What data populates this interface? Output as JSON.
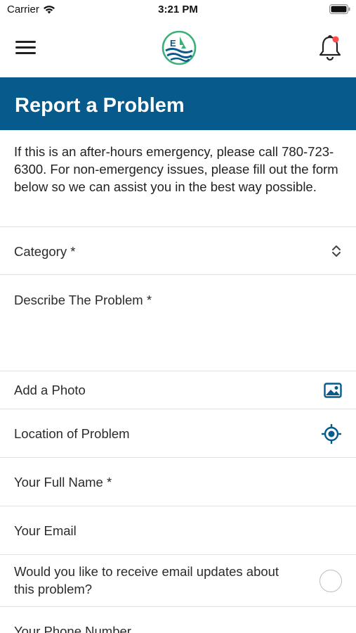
{
  "status_bar": {
    "carrier": "Carrier",
    "time": "3:21 PM"
  },
  "header": {
    "menu_icon": "hamburger-menu-icon",
    "logo_icon": "eq-logo-icon",
    "notification_icon": "bell-icon",
    "notification_dot_color": "#ff4b4b"
  },
  "title": {
    "text": "Report a Problem",
    "background": "#075a8c"
  },
  "intro": "If this is an after-hours emergency, please call 780-723-6300. For non-emergency issues, please fill out the form below so we can assist you in the best way possible.",
  "form": {
    "category_label": "Category *",
    "description_label": "Describe The Problem *",
    "photo_label": "Add a Photo",
    "location_label": "Location of Problem",
    "full_name_label": "Your Full Name *",
    "email_label": "Your Email",
    "email_updates_label": "Would you like to receive email updates about this problem?",
    "phone_label": "Your Phone Number"
  },
  "icons": {
    "category": "chevron-up-down-icon",
    "photo": "photo-icon",
    "location": "location-target-icon",
    "accent": "#075a8c"
  }
}
